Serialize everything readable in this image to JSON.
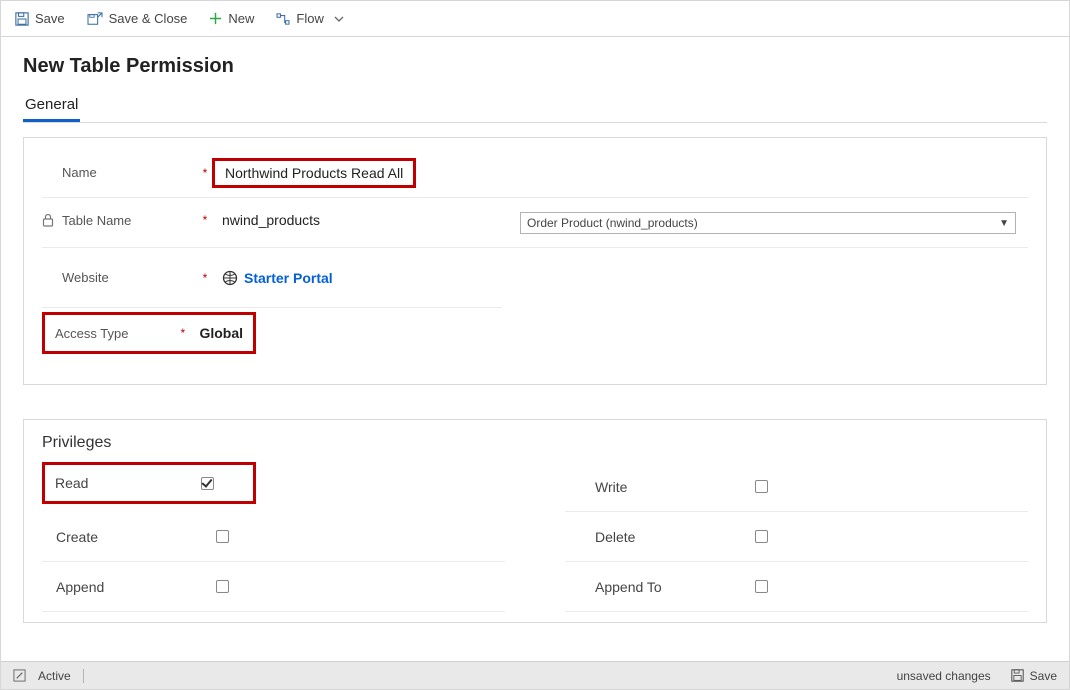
{
  "commands": {
    "save": "Save",
    "save_close": "Save & Close",
    "new": "New",
    "flow": "Flow"
  },
  "page": {
    "title": "New Table Permission"
  },
  "tabs": {
    "general": "General"
  },
  "fields": {
    "name": {
      "label": "Name",
      "value": "Northwind Products Read All"
    },
    "table_name": {
      "label": "Table Name",
      "value": "nwind_products"
    },
    "website": {
      "label": "Website",
      "value": "Starter Portal"
    },
    "access_type": {
      "label": "Access Type",
      "value": "Global"
    }
  },
  "table_dropdown": {
    "selected": "Order Product (nwind_products)"
  },
  "privileges": {
    "title": "Privileges",
    "read": "Read",
    "write": "Write",
    "create": "Create",
    "delete": "Delete",
    "append": "Append",
    "append_to": "Append To"
  },
  "status": {
    "active": "Active",
    "unsaved": "unsaved changes",
    "save": "Save"
  }
}
